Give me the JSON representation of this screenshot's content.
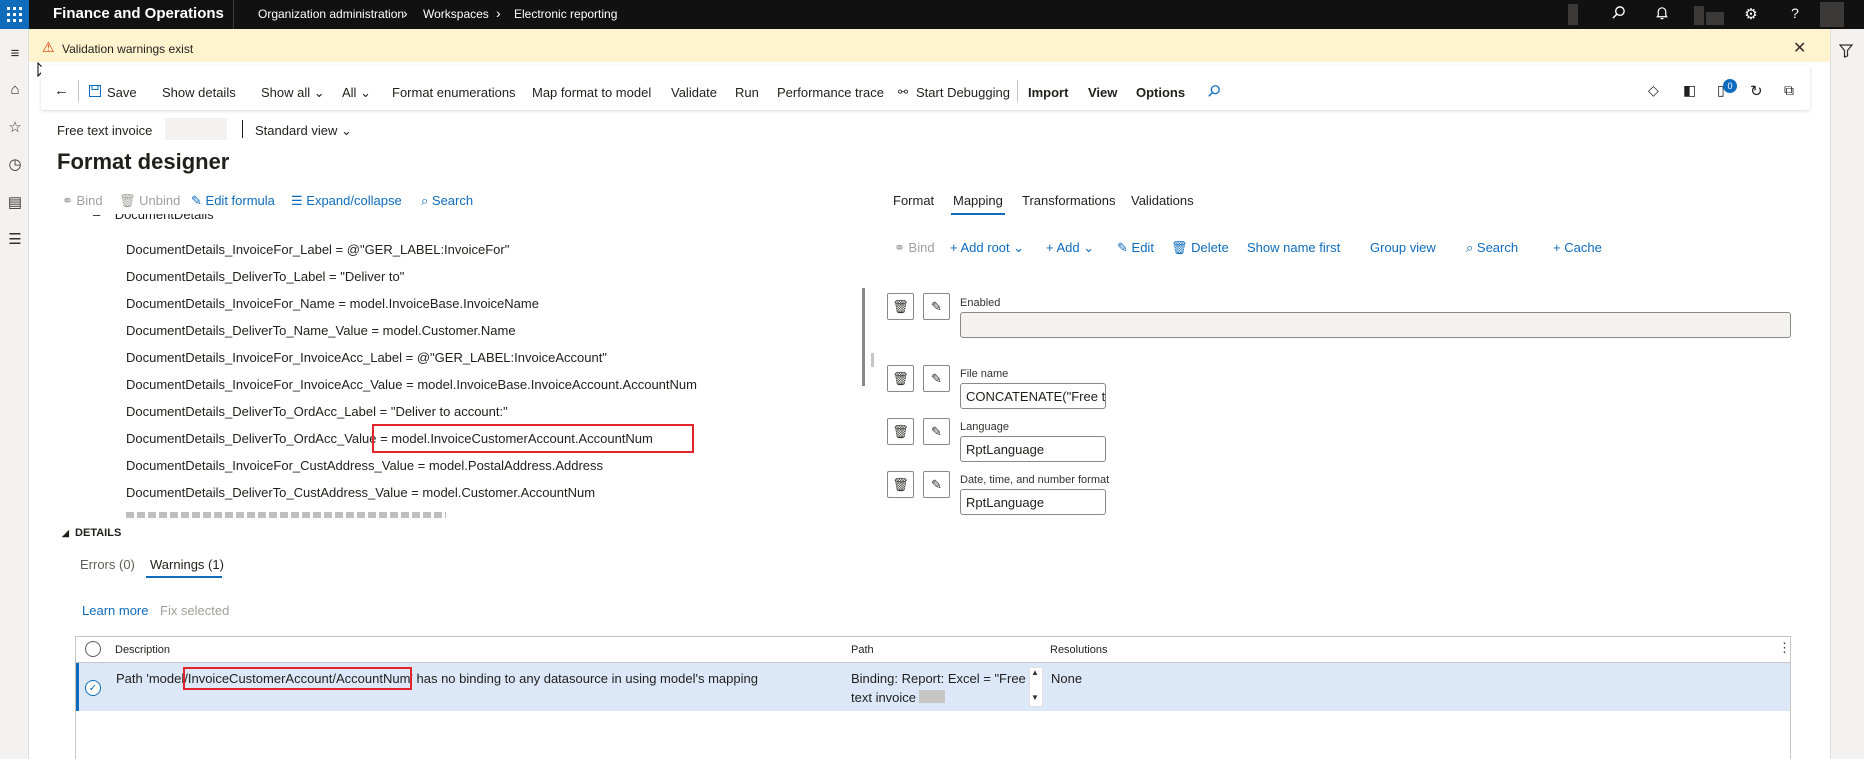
{
  "topbar": {
    "app_name": "Finance and Operations",
    "breadcrumbs": [
      "Organization administration",
      "Workspaces",
      "Electronic reporting"
    ]
  },
  "warning": {
    "text": "Validation warnings exist"
  },
  "actions": {
    "save": "Save",
    "show_details": "Show details",
    "show_all": "Show all",
    "all": "All",
    "format_enumerations": "Format enumerations",
    "map_format_to_model": "Map format to model",
    "validate": "Validate",
    "run": "Run",
    "performance_trace": "Performance trace",
    "start_debugging": "Start Debugging",
    "import": "Import",
    "view": "View",
    "options": "Options",
    "notification_count": "0"
  },
  "page": {
    "record_name": "Free text invoice",
    "view_selector": "Standard view",
    "title": "Format designer"
  },
  "tree_toolbar": {
    "bind": "Bind",
    "unbind": "Unbind",
    "edit_formula": "Edit formula",
    "expand_collapse": "Expand/collapse",
    "search": "Search"
  },
  "tree": {
    "parent": "DocumentDetails",
    "items": [
      "DocumentDetails_InvoiceFor_Label = @\"GER_LABEL:InvoiceFor\"",
      "DocumentDetails_DeliverTo_Label = \"Deliver to\"",
      "DocumentDetails_InvoiceFor_Name = model.InvoiceBase.InvoiceName",
      "DocumentDetails_DeliverTo_Name_Value = model.Customer.Name",
      "DocumentDetails_InvoiceFor_InvoiceAcc_Label = @\"GER_LABEL:InvoiceAccount\"",
      "DocumentDetails_InvoiceFor_InvoiceAcc_Value = model.InvoiceBase.InvoiceAccount.AccountNum",
      "DocumentDetails_DeliverTo_OrdAcc_Label = \"Deliver to account:\"",
      "DocumentDetails_DeliverTo_OrdAcc_Value = model.InvoiceCustomerAccount.AccountNum",
      "DocumentDetails_InvoiceFor_CustAddress_Value = model.PostalAddress.Address",
      "DocumentDetails_DeliverTo_CustAddress_Value = model.Customer.AccountNum"
    ]
  },
  "right_tabs": [
    "Format",
    "Mapping",
    "Transformations",
    "Validations"
  ],
  "mapping_toolbar": {
    "bind": "Bind",
    "add_root": "Add root",
    "add": "Add",
    "edit": "Edit",
    "delete": "Delete",
    "show_name_first": "Show name first",
    "group_view": "Group view",
    "search": "Search",
    "cache": "Cache"
  },
  "properties": {
    "enabled_label": "Enabled",
    "enabled_value": "",
    "file_name_label": "File name",
    "file_name_value": "CONCATENATE(\"Free t...",
    "language_label": "Language",
    "language_value": "RptLanguage",
    "datetime_label": "Date, time, and number format",
    "datetime_value": "RptLanguage"
  },
  "details": {
    "header": "DETAILS",
    "tabs": [
      "Errors (0)",
      "Warnings (1)"
    ],
    "learn_more": "Learn more",
    "fix_selected": "Fix selected",
    "columns": [
      "Description",
      "Path",
      "Resolutions"
    ],
    "row": {
      "description_pre": "Path 'model/",
      "description_hl": "InvoiceCustomerAccount/AccountNum'",
      "description_post": " has no binding to any datasource in using model's mapping",
      "path_line1": "Binding: Report: Excel = \"Free",
      "path_line2": "text invoice .",
      "resolution": "None"
    }
  }
}
